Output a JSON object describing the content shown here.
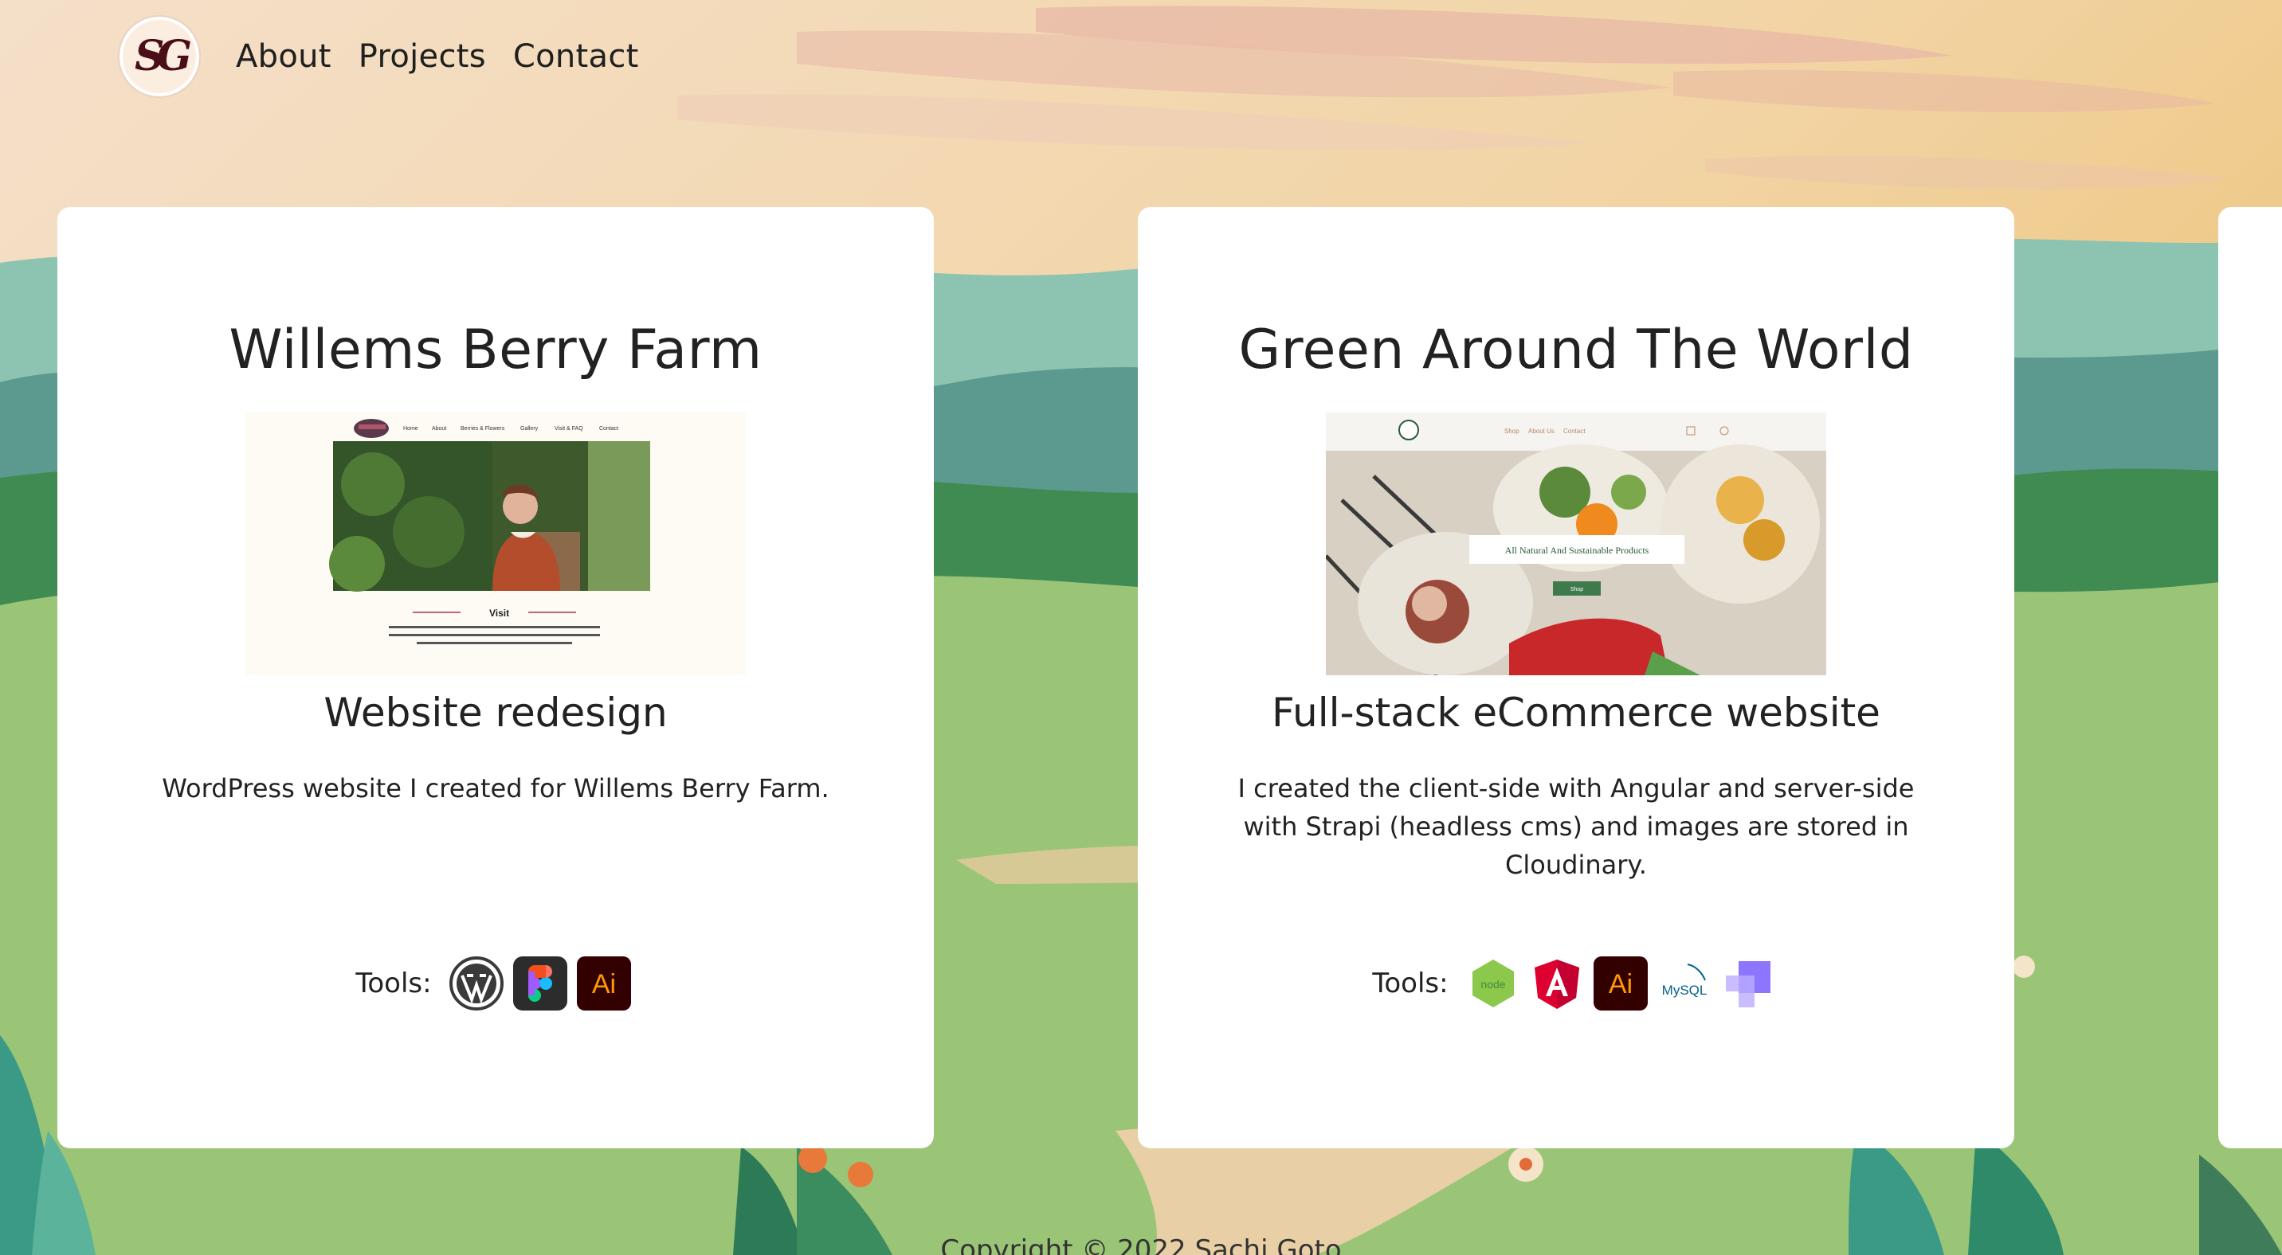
{
  "nav": {
    "logo_text": "SG",
    "links": [
      "About",
      "Projects",
      "Contact"
    ]
  },
  "projects": [
    {
      "title": "Willems Berry Farm",
      "subtitle": "Website redesign",
      "description": "WordPress website I created for Willems Berry Farm.",
      "tools_label": "Tools:",
      "tools": [
        "wordpress-icon",
        "figma-icon",
        "illustrator-icon"
      ],
      "preview": {
        "nav_items": [
          "Home",
          "About",
          "Berries & Flowers",
          "Gallery",
          "Visit & FAQ",
          "Contact"
        ],
        "heading": "Visit",
        "body": "The farm is a beautiful place to come enjoy an afternoon picking berries, enjoying the sun, spending time together as a family! In addition to berries, we have a large flower garden and sell beautiful fresh-cut flowers."
      }
    },
    {
      "title": "Green Around The World",
      "subtitle": "Full-stack eCommerce website",
      "description": "I created the client-side with Angular and server-side with Strapi (headless cms) and images are stored in Cloudinary.",
      "tools_label": "Tools:",
      "tools": [
        "nodejs-icon",
        "angular-icon",
        "illustrator-icon",
        "mysql-icon",
        "strapi-icon"
      ],
      "preview": {
        "nav_items": [
          "Shop",
          "About Us",
          "Contact"
        ],
        "banner": "All Natural And Sustainable Products",
        "button": "Shop"
      }
    }
  ],
  "tool_labels": {
    "illustrator": "Ai",
    "nodejs": "node",
    "mysql": "MySQL"
  },
  "footer": {
    "text": "Copyright © 2022 Sachi Goto"
  },
  "colors": {
    "sky": "#f3d9b6",
    "hill_green": "#9ac577",
    "dark_green": "#4e9a4f",
    "teal": "#5fb7a1",
    "card": "#ffffff",
    "logo_maroon": "#4a0f16"
  }
}
